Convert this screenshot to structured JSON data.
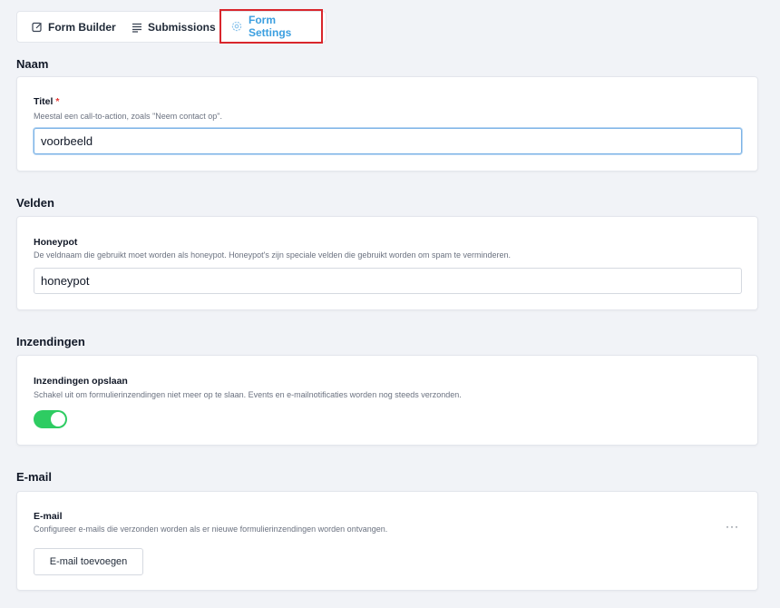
{
  "tabs": [
    {
      "label": "Form Builder",
      "icon": "edit-icon"
    },
    {
      "label": "Submissions",
      "icon": "list-icon"
    },
    {
      "label": "Form Settings",
      "icon": "gear-icon",
      "active": true
    }
  ],
  "sections": {
    "naam": {
      "title": "Naam",
      "field_label": "Titel",
      "required_mark": "*",
      "help": "Meestal een call-to-action, zoals \"Neem contact op\".",
      "value": "voorbeeld"
    },
    "velden": {
      "title": "Velden",
      "field_label": "Honeypot",
      "help": "De veldnaam die gebruikt moet worden als honeypot. Honeypot's zijn speciale velden die gebruikt worden om spam te verminderen.",
      "value": "honeypot"
    },
    "inzendingen": {
      "title": "Inzendingen",
      "field_label": "Inzendingen opslaan",
      "help": "Schakel uit om formulierinzendingen niet meer op te slaan. Events en e-mailnotificaties worden nog steeds verzonden.",
      "toggle_on": true
    },
    "email": {
      "title": "E-mail",
      "field_label": "E-mail",
      "help": "Configureer e-mails die verzonden worden als er nieuwe formulierinzendingen worden ontvangen.",
      "button_label": "E-mail toevoegen",
      "menu_label": "···"
    }
  },
  "colors": {
    "accent": "#3b9fe0",
    "highlight_border": "#d9262c",
    "toggle_on": "#2ecc62",
    "background": "#f1f3f7"
  }
}
